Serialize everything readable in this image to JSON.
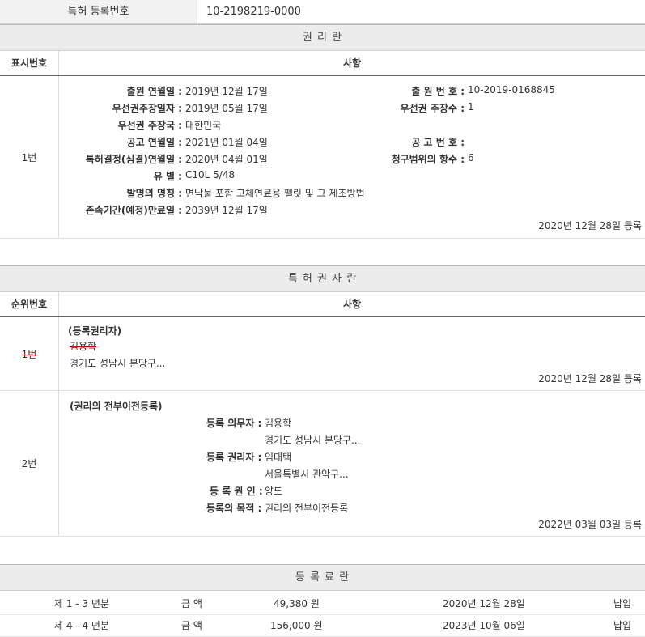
{
  "header": {
    "label": "특허 등록번호",
    "value": "10-2198219-0000"
  },
  "rights": {
    "title": "권 리 란",
    "col1": "표시번호",
    "col2": "사항",
    "row_num": "1번",
    "left": [
      {
        "label": "출원 연월일 :",
        "value": "2019년 12월 17일"
      },
      {
        "label": "우선권주장일자 :",
        "value": "2019년 05월 17일"
      },
      {
        "label": "우선권 주장국 :",
        "value": "대한민국"
      },
      {
        "label": "공고 연월일 :",
        "value": "2021년 01월 04일"
      },
      {
        "label": "특허결정(심결)연월일 :",
        "value": "2020년 04월 01일"
      },
      {
        "label": "유 별 :",
        "value": "C10L 5/48"
      },
      {
        "label": "발명의 명칭 :",
        "value": "면낙물 포함 고체연료용 펠릿 및 그 제조방법"
      },
      {
        "label": "존속기간(예정)만료일 :",
        "value": "2039년 12월 17일"
      }
    ],
    "right": [
      {
        "label": "출 원 번 호 :",
        "value": "10-2019-0168845"
      },
      {
        "label": "우선권 주장수 :",
        "value": "1"
      },
      {
        "label": "공 고 번 호 :",
        "value": ""
      },
      {
        "label": "청구범위의 항수 :",
        "value": "6"
      }
    ],
    "reg_date": "2020년 12월 28일 등록"
  },
  "holders": {
    "title": "특 허 권 자 란",
    "col1": "순위번호",
    "col2": "사항",
    "rows": [
      {
        "num": "1번",
        "heading": "(등록권리자)",
        "name": "김용학",
        "address": "경기도 성남시 분당구...",
        "reg_date": "2020년 12월 28일 등록"
      },
      {
        "num": "2번",
        "heading": "(권리의 전부이전등록)",
        "obligor_label": "등록 의무자 :",
        "obligor_name": "김용학",
        "obligor_address": "경기도 성남시 분당구...",
        "holder_label": "등록 권리자 :",
        "holder_name": "임대택",
        "holder_address": "서울특별시 관악구...",
        "cause_label": "등 록 원 인 :",
        "cause": "양도",
        "purpose_label": "등록의 목적 :",
        "purpose": "권리의 전부이전등록",
        "reg_date": "2022년 03월 03일 등록"
      }
    ]
  },
  "fees": {
    "title": "등 록 료 란",
    "rows": [
      {
        "period": "제 1 - 3 년분",
        "amount_label": "금 액",
        "amount": "49,380 원",
        "date": "2020년 12월 28일",
        "status": "납입"
      },
      {
        "period": "제 4 - 4 년분",
        "amount_label": "금 액",
        "amount": "156,000 원",
        "date": "2023년 10월 06일",
        "status": "납입"
      }
    ]
  }
}
